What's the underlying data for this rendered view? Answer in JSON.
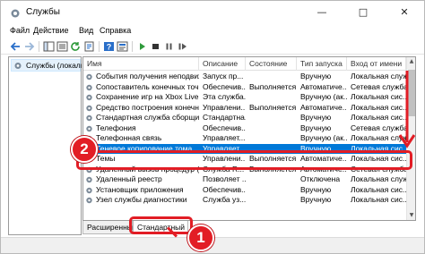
{
  "window": {
    "title": "Службы"
  },
  "menu": [
    {
      "label": "Файл"
    },
    {
      "label": "Действие"
    },
    {
      "label": "Вид"
    },
    {
      "label": "Справка"
    }
  ],
  "tree": {
    "root_label": "Службы (локаль"
  },
  "columns": [
    "Имя",
    "Описание",
    "Состояние",
    "Тип запуска",
    "Вход от имени"
  ],
  "rows": [
    {
      "name": "События получения неподвиж...",
      "desc": "Запуск пр...",
      "state": "",
      "start": "Вручную",
      "logon": "Локальная служ"
    },
    {
      "name": "Сопоставитель конечных точ...",
      "desc": "Обеспечив...",
      "state": "Выполняется",
      "start": "Автоматиче...",
      "logon": "Сетевая служба"
    },
    {
      "name": "Сохранение игр на Xbox Live",
      "desc": "Эта служба...",
      "state": "",
      "start": "Вручную (ак...",
      "logon": "Локальная сис..."
    },
    {
      "name": "Средство построения конечны...",
      "desc": "Управлени...",
      "state": "Выполняется",
      "start": "Автоматиче...",
      "logon": "Локальная сис..."
    },
    {
      "name": "Стандартная служба сборщика...",
      "desc": "Стандартна...",
      "state": "",
      "start": "Вручную",
      "logon": "Локальная сис..."
    },
    {
      "name": "Телефония",
      "desc": "Обеспечив...",
      "state": "",
      "start": "Вручную",
      "logon": "Сетевая служба"
    },
    {
      "name": "Телефонная связь",
      "desc": "Управляет...",
      "state": "",
      "start": "Вручную (ак...",
      "logon": "Локальная служ"
    },
    {
      "name": "Теневое копирование тома",
      "desc": "Управляет...",
      "state": "",
      "start": "Вручную",
      "logon": "Локальная сис..."
    },
    {
      "name": "Темы",
      "desc": "Управлени...",
      "state": "Выполняется",
      "start": "Автоматиче...",
      "logon": "Локальная сис..."
    },
    {
      "name": "Удаленный вызов процедур (RPC)",
      "desc": "Служба R...",
      "state": "Выполняется",
      "start": "Автоматиче...",
      "logon": "Сетевая служба"
    },
    {
      "name": "Удаленный реестр",
      "desc": "Позволяет ...",
      "state": "",
      "start": "Отключена",
      "logon": "Локальная служ"
    },
    {
      "name": "Установщик приложения",
      "desc": "Обеспечив...",
      "state": "",
      "start": "Вручную",
      "logon": "Локальная сис..."
    },
    {
      "name": "Узел службы диагностики",
      "desc": "Служба уз...",
      "state": "",
      "start": "Вручную",
      "logon": "Локальная сис..."
    }
  ],
  "selected_row_index": 7,
  "tabs": [
    {
      "label": "Расширенный"
    },
    {
      "label": "Стандартный"
    }
  ],
  "callouts": [
    {
      "number": "1"
    },
    {
      "number": "2"
    }
  ],
  "colors": {
    "selection": "#0078d7",
    "highlight": "#e21d25"
  }
}
